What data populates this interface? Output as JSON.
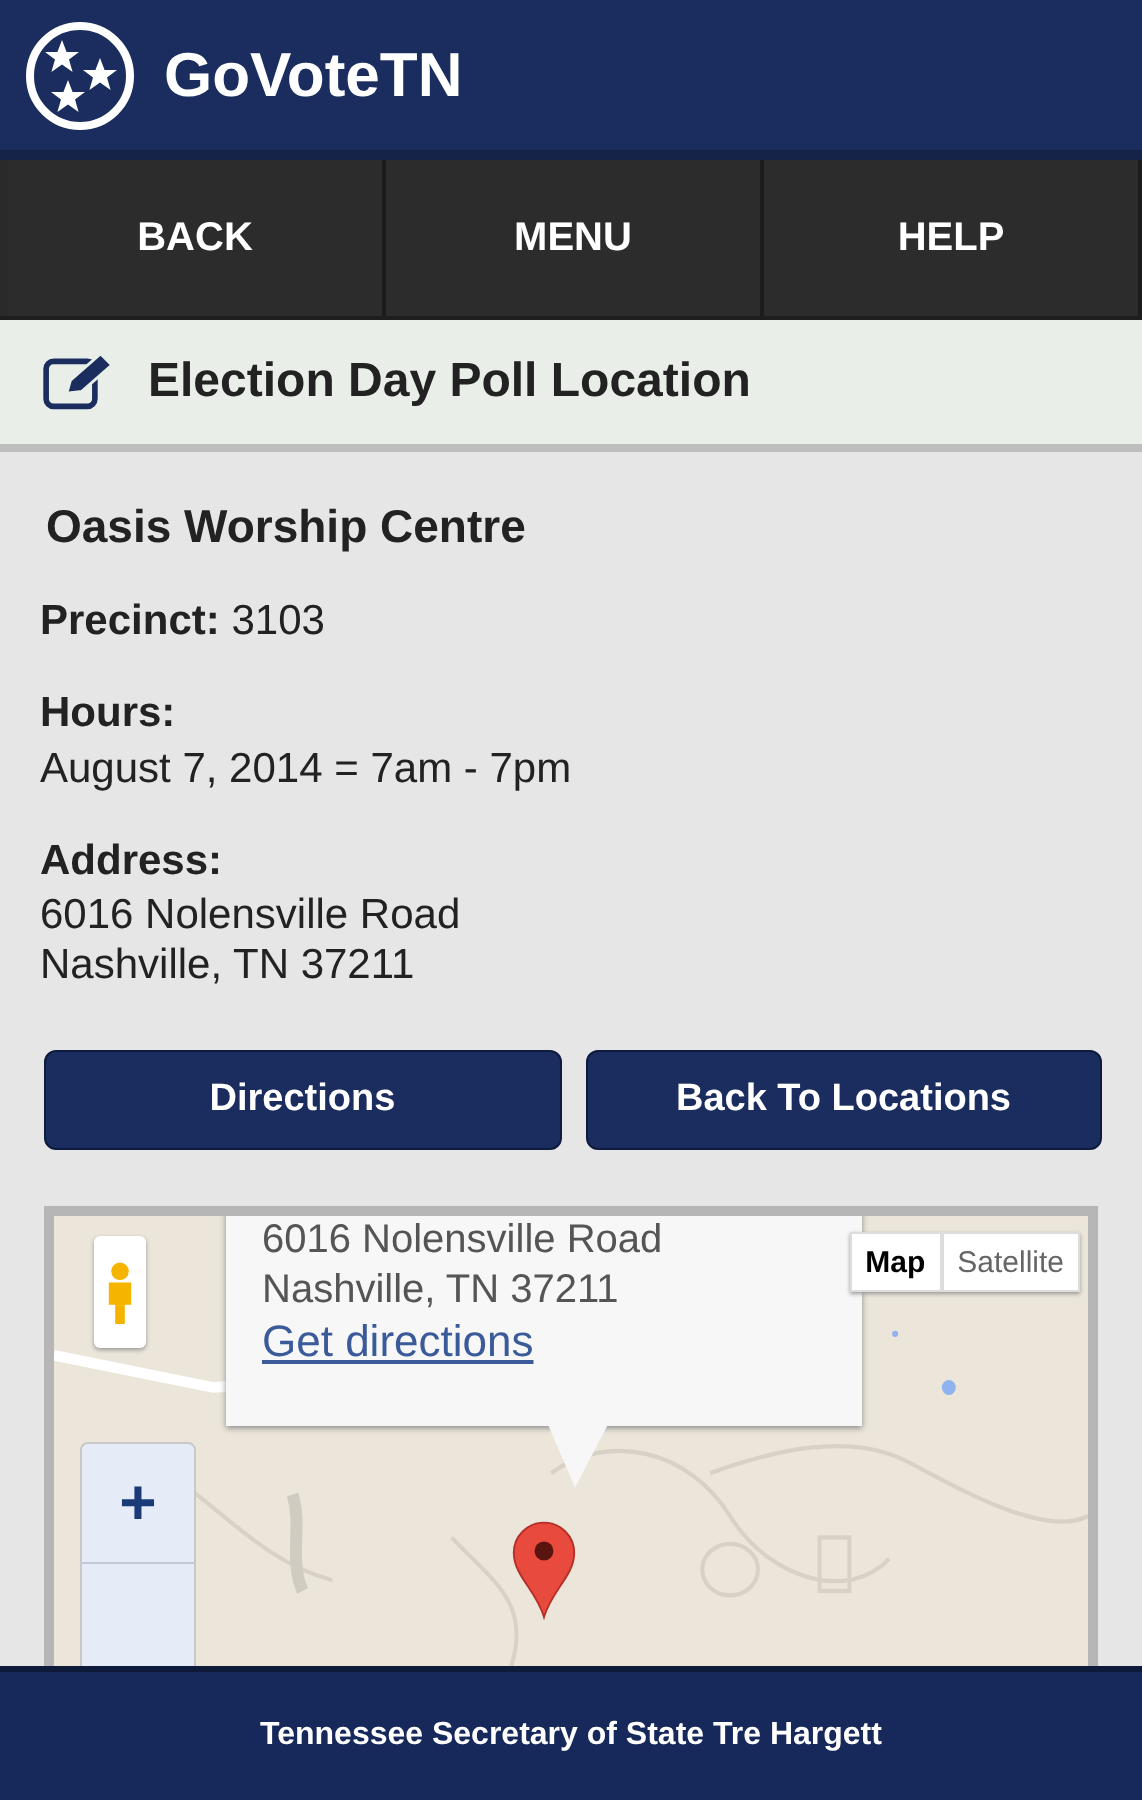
{
  "app": {
    "title": "GoVoteTN"
  },
  "nav": [
    {
      "label": "BACK"
    },
    {
      "label": "MENU"
    },
    {
      "label": "HELP"
    }
  ],
  "page_title": "Election Day Poll Location",
  "location": {
    "name": "Oasis Worship Centre",
    "precinct_label": "Precinct:",
    "precinct": "3103",
    "hours_label": "Hours:",
    "hours": "August 7, 2014 = 7am - 7pm",
    "address_label": "Address:",
    "address_lines": [
      "6016 Nolensville Road",
      "Nashville, TN 37211"
    ]
  },
  "buttons": [
    {
      "label": "Directions"
    },
    {
      "label": "Back To Locations"
    }
  ],
  "map": {
    "popup_lines": [
      "6016 Nolensville Road",
      "Nashville, TN 37211"
    ],
    "popup_link": "Get directions",
    "map_types": [
      {
        "label": "Map",
        "selected": true
      },
      {
        "label": "Satellite",
        "selected": false
      }
    ],
    "zoom_in": "+"
  },
  "footer": "Tennessee Secretary of State Tre Hargett"
}
